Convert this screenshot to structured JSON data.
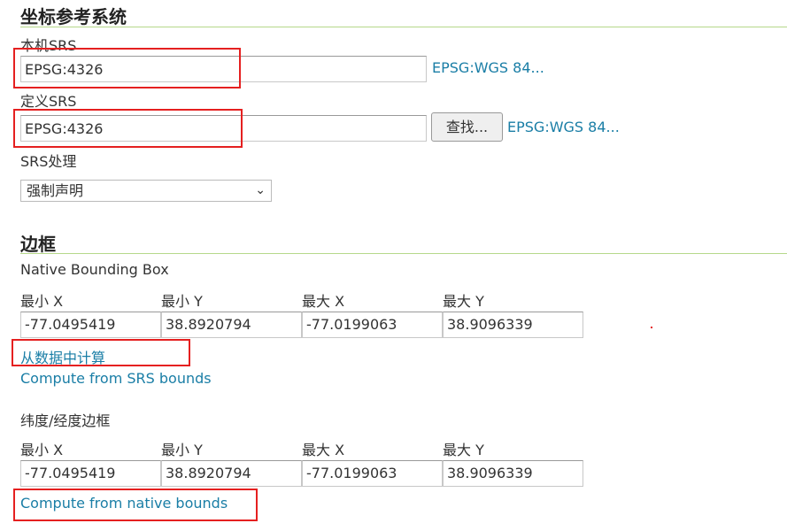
{
  "crs": {
    "heading": "坐标参考系统",
    "native_label": "本机SRS",
    "native_value": "EPSG:4326",
    "native_link": "EPSG:WGS 84...",
    "declared_label": "定义SRS",
    "declared_value": "EPSG:4326",
    "find_button": "查找...",
    "declared_link": "EPSG:WGS 84...",
    "handling_label": "SRS处理",
    "handling_value": "强制声明"
  },
  "bbox": {
    "heading": "边框",
    "native": {
      "title": "Native Bounding Box",
      "labels": [
        "最小 X",
        "最小 Y",
        "最大 X",
        "最大 Y"
      ],
      "values": [
        "-77.0495419",
        "38.8920794",
        "-77.0199063",
        "38.9096339"
      ],
      "compute_data": "从数据中计算",
      "compute_srs": "Compute from SRS bounds"
    },
    "latlon": {
      "title": "纬度/经度边框",
      "labels": [
        "最小 X",
        "最小 Y",
        "最大 X",
        "最大 Y"
      ],
      "values": [
        "-77.0495419",
        "38.8920794",
        "-77.0199063",
        "38.9096339"
      ],
      "compute_native": "Compute from native bounds"
    }
  },
  "colors": {
    "link": "#1a7ea6",
    "rule": "#b6d88a",
    "highlight": "#e52020"
  }
}
